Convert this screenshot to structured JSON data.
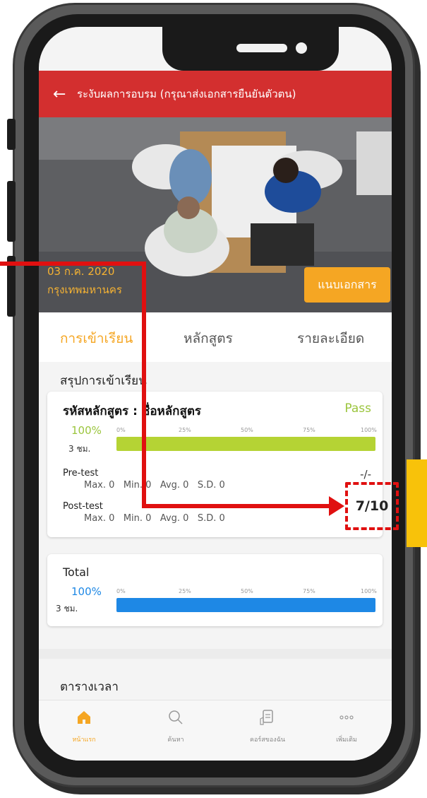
{
  "header": {
    "title": "ระงับผลการอบรม (กรุณาส่งเอกสารยืนยันตัวตน)"
  },
  "hero": {
    "date": "03 ก.ค. 2020",
    "place": "กรุงเทพมหานคร",
    "attach_button": "แนบเอกสาร"
  },
  "tabs": [
    {
      "label": "การเข้าเรียน",
      "active": true
    },
    {
      "label": "หลักสูตร",
      "active": false
    },
    {
      "label": "รายละเอียด",
      "active": false
    }
  ],
  "summary": {
    "title": "สรุปการเข้าเรียน",
    "course_code_name": "รหัสหลักสูตร : ชื่อหลักสูตร",
    "status": "Pass",
    "progress_label": "100%",
    "progress_value": 1.0,
    "hours": "3 ชม.",
    "scale": [
      "0%",
      "25%",
      "50%",
      "75%",
      "100%"
    ],
    "pretest": {
      "label": "Pre-test",
      "max": "Max. 0",
      "min": "Min. 0",
      "avg": "Avg. 0",
      "sd": "S.D. 0",
      "score": "-/-"
    },
    "posttest": {
      "label": "Post-test",
      "max": "Max. 0",
      "min": "Min. 0",
      "avg": "Avg. 0",
      "sd": "S.D. 0",
      "score": "7/10"
    }
  },
  "total": {
    "label": "Total",
    "progress_label": "100%",
    "progress_value": 1.0,
    "hours": "3 ชม.",
    "scale": [
      "0%",
      "25%",
      "50%",
      "75%",
      "100%"
    ]
  },
  "schedule": {
    "title": "ตารางเวลา"
  },
  "bottom_nav": [
    {
      "label": "หน้าแรก",
      "icon": "home-icon",
      "active": true
    },
    {
      "label": "ค้นหา",
      "icon": "search-icon",
      "active": false
    },
    {
      "label": "คอร์สของฉัน",
      "icon": "course-icon",
      "active": false
    },
    {
      "label": "เพิ่มเติม",
      "icon": "more-icon",
      "active": false
    }
  ],
  "colors": {
    "header_red": "#d32f2f",
    "accent_orange": "#f5a623",
    "pass_green": "#b5d334",
    "total_blue": "#1e88e5",
    "annotation_red": "#e01010",
    "annotation_yellow": "#f8c20a"
  }
}
